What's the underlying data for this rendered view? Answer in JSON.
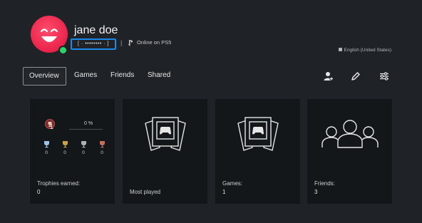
{
  "profile": {
    "username": "jane doe",
    "online_id_masked": "[ · •••••••• · ]",
    "separator": "|",
    "online_status": "Online on PS5",
    "language": "English (United States)"
  },
  "tabs": [
    {
      "label": "Overview",
      "active": true
    },
    {
      "label": "Games",
      "active": false
    },
    {
      "label": "Friends",
      "active": false
    },
    {
      "label": "Shared",
      "active": false
    }
  ],
  "toolbar": {
    "icons": [
      "add-friend-icon",
      "edit-pencil-icon",
      "settings-sliders-icon"
    ]
  },
  "trophies": {
    "level": "1",
    "progress_text": "0 %",
    "progress_fraction": 0,
    "counts": {
      "platinum": "0",
      "gold": "0",
      "silver": "0",
      "bronze": "0"
    },
    "title": "Trophies earned:",
    "earned": "0"
  },
  "cards": {
    "most_played": {
      "title": "Most played"
    },
    "games": {
      "title": "Games:",
      "value": "1"
    },
    "friends": {
      "title": "Friends:",
      "value": "3"
    }
  },
  "colors": {
    "background": "#1f2226",
    "card": "#14171a",
    "avatar": "#e0103c",
    "online": "#2ed36b",
    "id_highlight": "#1c88e8"
  }
}
